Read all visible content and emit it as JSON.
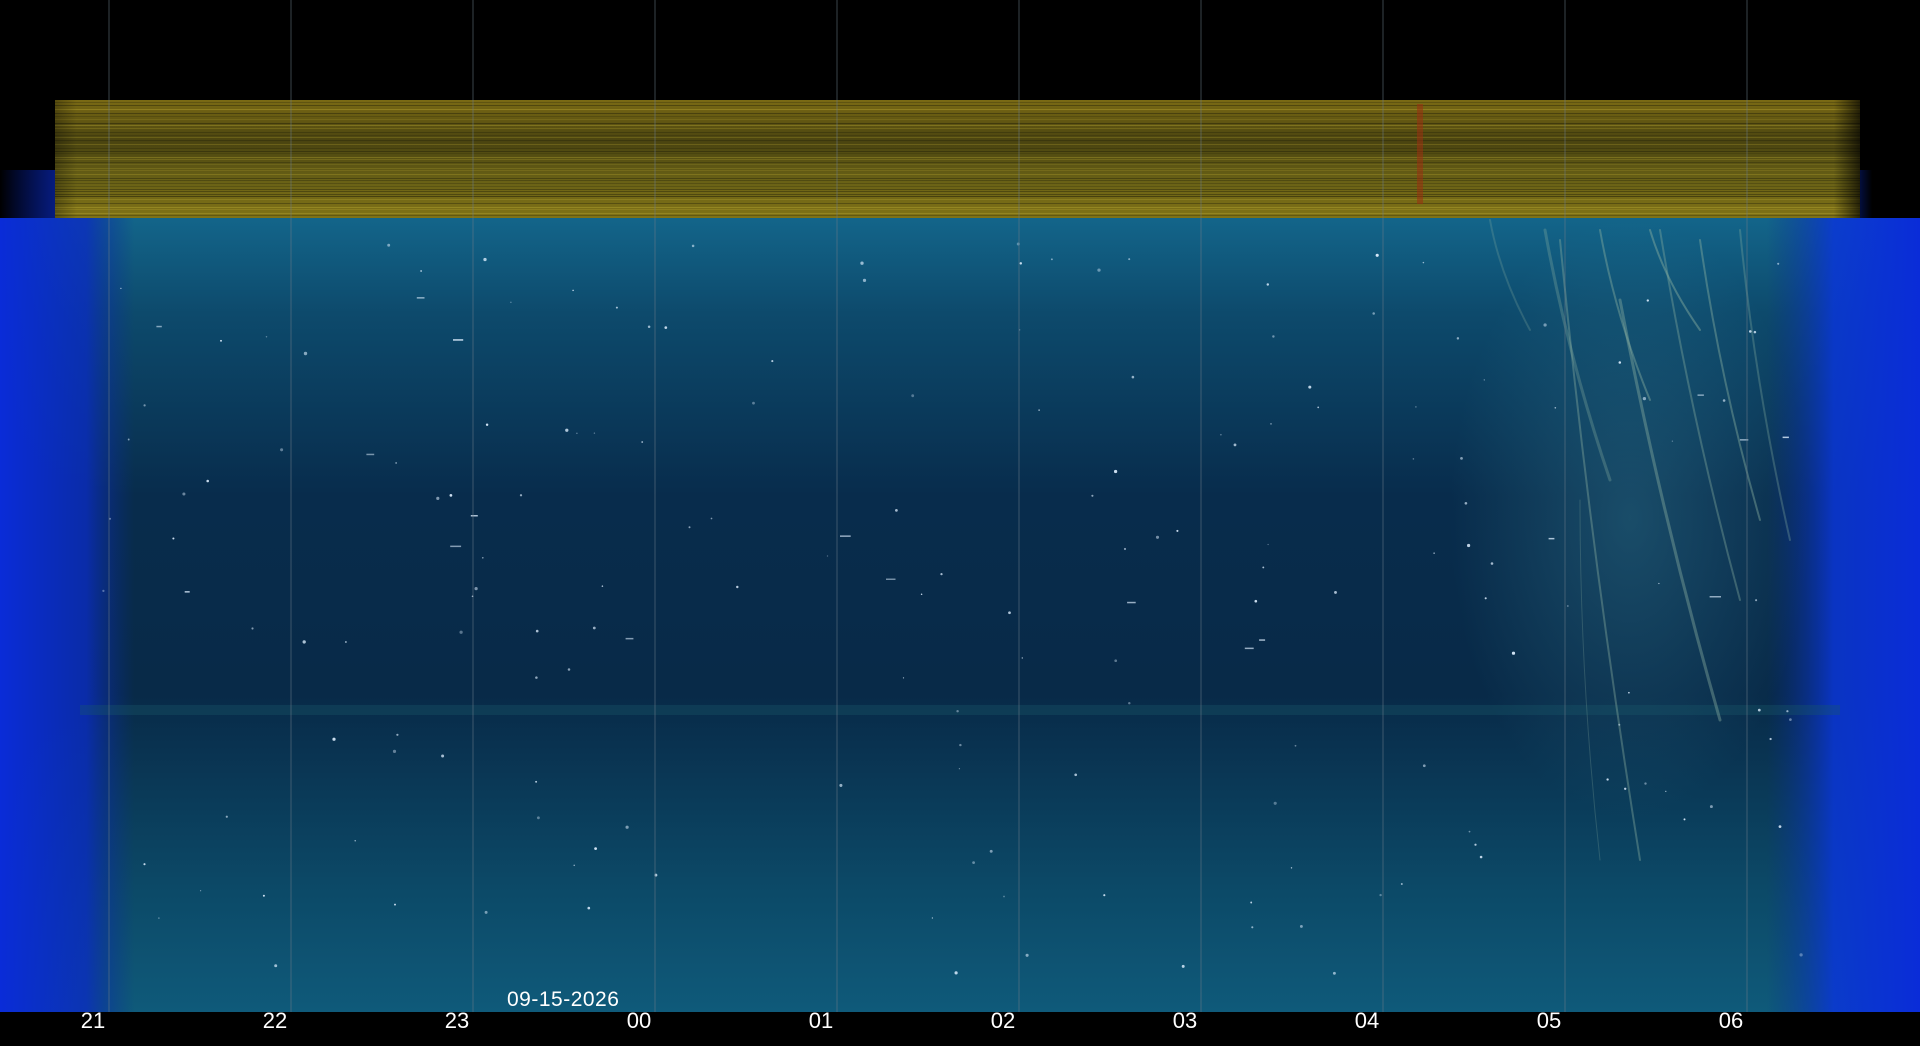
{
  "image": {
    "kind": "keogram",
    "date_label": "09-15-2026",
    "hour_labels": [
      "21",
      "22",
      "23",
      "00",
      "01",
      "02",
      "03",
      "04",
      "05",
      "06"
    ],
    "colors": {
      "background": "#000000",
      "sky_top": "#0e5a7a",
      "sky_bottom": "#0a2a4a",
      "twilight_edges": "#0a2ad0",
      "horizon_band": "#6a6010",
      "grid_lines": "#5a6a7a"
    }
  }
}
